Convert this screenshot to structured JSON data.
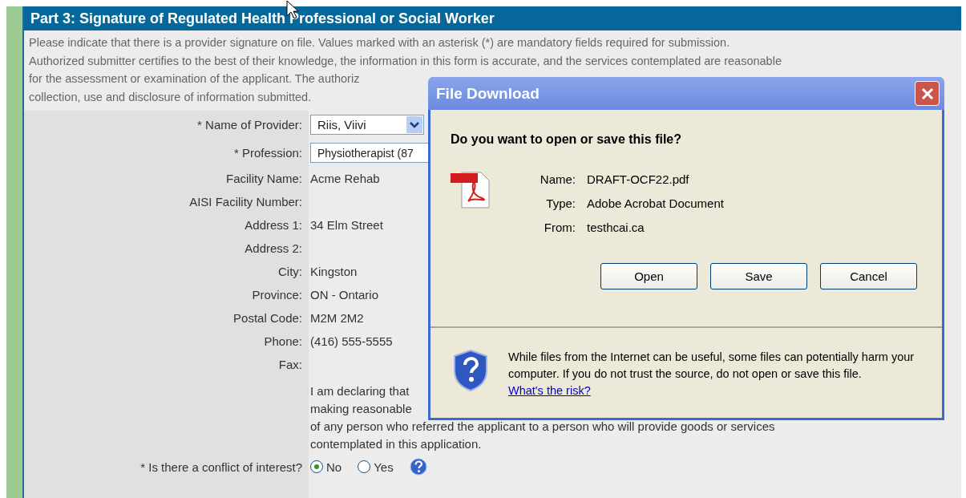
{
  "section": {
    "title": "Part 3: Signature of Regulated Health Professional or Social Worker",
    "intro_lines": [
      "Please indicate that there is a provider signature on file. Values marked with an asterisk (*) are mandatory fields required for submission.",
      "Authorized submitter certifies to the best of their knowledge, the information in this form is accurate, and the services contemplated are reasonable",
      "for the assessment or examination of the applicant. The authoriz",
      "collection, use and disclosure of information submitted."
    ]
  },
  "form": {
    "fields": [
      {
        "label": "* Name of Provider:",
        "kind": "select",
        "value": "Riis, Viivi"
      },
      {
        "label": "* Profession:",
        "kind": "input",
        "value": "Physiotherapist (87"
      },
      {
        "label": "Facility Name:",
        "kind": "text",
        "value": "Acme Rehab"
      },
      {
        "label": "AISI Facility Number:",
        "kind": "text"
      },
      {
        "label": "Address 1:",
        "kind": "text",
        "value": "34 Elm Street"
      },
      {
        "label": "Address 2:",
        "kind": "text"
      },
      {
        "label": "City:",
        "kind": "text",
        "value": "Kingston"
      },
      {
        "label": "Province:",
        "kind": "text",
        "value": "ON - Ontario"
      },
      {
        "label": "Postal Code:",
        "kind": "text",
        "value": "M2M 2M2"
      },
      {
        "label": "Phone:",
        "kind": "text",
        "value": "(416) 555-5555"
      },
      {
        "label": "Fax:",
        "kind": "text"
      }
    ],
    "declaration_lines": [
      "I am declaring that",
      "making reasonable",
      "of any person who referred the applicant to a person who will provide goods or services",
      "contemplated in this application."
    ],
    "conflict": {
      "label": "* Is there a conflict of interest?",
      "options": [
        {
          "label": "No",
          "selected": true
        },
        {
          "label": "Yes",
          "selected": false
        }
      ]
    }
  },
  "dialog": {
    "title": "File Download",
    "question": "Do you want to open or save this file?",
    "details": [
      {
        "label": "Name:",
        "value": "DRAFT-OCF22.pdf"
      },
      {
        "label": "Type:",
        "value": "Adobe Acrobat Document"
      },
      {
        "label": "From:",
        "value": "testhcai.ca"
      }
    ],
    "buttons": [
      "Open",
      "Save",
      "Cancel"
    ],
    "warning": "While files from the Internet can be useful, some files can potentially harm your computer. If you do not trust the source, do not open or save this file.",
    "link": "What's the risk?"
  }
}
